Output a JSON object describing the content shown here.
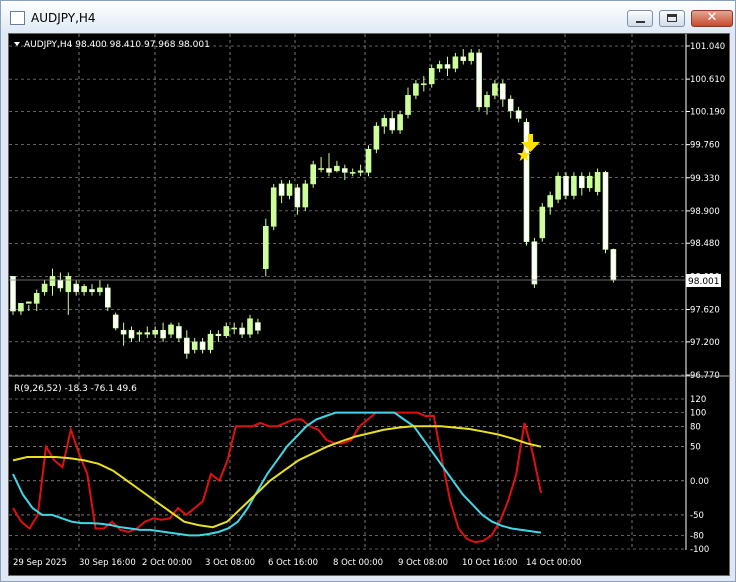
{
  "window": {
    "title": "AUDJPY,H4",
    "buttons": {
      "minimize": "minimize",
      "maximize": "maximize",
      "close": "close"
    },
    "icons": {
      "app": "chart-window-icon",
      "close_glyph": "✕"
    }
  },
  "chart": {
    "header": "AUDJPY,H4  98.400 98.410 97.968 98.001",
    "current_price_label": "98.001",
    "price_axis": [
      "101.040",
      "100.610",
      "100.190",
      "99.760",
      "99.330",
      "98.900",
      "98.480",
      "98.050",
      "97.620",
      "97.200",
      "96.770"
    ],
    "indicator_header": "R(9,26,52) -18.3 -76.1 49.6",
    "indicator_axis": [
      "120",
      "100",
      "80",
      "50",
      "0.00",
      "-50",
      "-80",
      "-100"
    ],
    "time_axis": [
      "29 Sep 2025",
      "30 Sep 16:00",
      "2 Oct 00:00",
      "3 Oct 08:00",
      "6 Oct 16:00",
      "8 Oct 00:00",
      "9 Oct 08:00",
      "10 Oct 16:00",
      "14 Oct 00:00"
    ],
    "colors": {
      "background": "#000000",
      "grid": "#c0c0c0",
      "candle": "#ccff99",
      "line_red": "#e01010",
      "line_cyan": "#40d8e8",
      "line_yellow": "#e8e020",
      "arrow": "#ffe000",
      "text": "#ffffff"
    },
    "icons": {
      "sell_arrow": "down-arrow-icon",
      "signal_star": "star-icon",
      "dropdown": "triangle-down-icon"
    }
  },
  "chart_data": {
    "type": "candlestick",
    "symbol": "AUDJPY",
    "timeframe": "H4",
    "ohlc_last": {
      "open": 98.4,
      "high": 98.41,
      "low": 97.968,
      "close": 98.001
    },
    "ylim": [
      96.77,
      101.04
    ],
    "candles": [
      [
        98.05,
        97.6,
        97.93,
        97.55
      ],
      [
        97.6,
        97.7,
        97.63,
        97.55
      ],
      [
        97.7,
        97.72,
        97.68,
        97.6
      ],
      [
        97.7,
        97.83,
        97.88,
        97.6
      ],
      [
        97.85,
        97.95,
        98.0,
        97.8
      ],
      [
        97.93,
        98.05,
        98.15,
        97.8
      ],
      [
        98.0,
        97.9,
        98.1,
        97.85
      ],
      [
        97.85,
        98.05,
        98.1,
        97.55
      ],
      [
        97.95,
        97.85,
        98.0,
        97.8
      ],
      [
        97.85,
        97.92,
        97.95,
        97.8
      ],
      [
        97.88,
        97.85,
        97.95,
        97.8
      ],
      [
        97.85,
        97.9,
        98.0,
        97.8
      ],
      [
        97.9,
        97.65,
        97.95,
        97.6
      ],
      [
        97.55,
        97.38,
        97.58,
        97.35
      ],
      [
        97.35,
        97.3,
        97.45,
        97.15
      ],
      [
        97.35,
        97.25,
        97.4,
        97.2
      ],
      [
        97.3,
        97.32,
        97.35,
        97.2
      ],
      [
        97.32,
        97.3,
        97.4,
        97.25
      ],
      [
        97.3,
        97.35,
        97.4,
        97.25
      ],
      [
        97.35,
        97.25,
        97.45,
        97.2
      ],
      [
        97.3,
        97.42,
        97.45,
        97.25
      ],
      [
        97.4,
        97.25,
        97.45,
        97.2
      ],
      [
        97.25,
        97.05,
        97.35,
        96.98
      ],
      [
        97.1,
        97.2,
        97.25,
        97.05
      ],
      [
        97.2,
        97.1,
        97.25,
        97.05
      ],
      [
        97.1,
        97.3,
        97.35,
        97.05
      ],
      [
        97.3,
        97.28,
        97.35,
        97.2
      ],
      [
        97.28,
        97.4,
        97.45,
        97.25
      ],
      [
        97.38,
        97.38,
        97.45,
        97.3
      ],
      [
        97.38,
        97.3,
        97.45,
        97.25
      ],
      [
        97.3,
        97.5,
        97.55,
        97.25
      ],
      [
        97.45,
        97.35,
        97.5,
        97.3
      ],
      [
        98.15,
        98.7,
        98.8,
        98.05
      ],
      [
        98.7,
        99.2,
        99.25,
        98.65
      ],
      [
        99.25,
        99.1,
        99.3,
        99.0
      ],
      [
        99.1,
        99.25,
        99.3,
        99.05
      ],
      [
        99.2,
        98.95,
        99.25,
        98.85
      ],
      [
        98.95,
        99.25,
        99.3,
        98.9
      ],
      [
        99.25,
        99.5,
        99.55,
        99.2
      ],
      [
        99.45,
        99.45,
        99.6,
        99.4
      ],
      [
        99.45,
        99.4,
        99.65,
        99.35
      ],
      [
        99.42,
        99.48,
        99.55,
        99.4
      ],
      [
        99.45,
        99.4,
        99.5,
        99.3
      ],
      [
        99.4,
        99.4,
        99.45,
        99.35
      ],
      [
        99.4,
        99.42,
        99.5,
        99.35
      ],
      [
        99.4,
        99.7,
        99.75,
        99.35
      ],
      [
        99.7,
        100.0,
        100.05,
        99.65
      ],
      [
        100.0,
        100.1,
        100.15,
        99.9
      ],
      [
        100.1,
        99.95,
        100.2,
        99.9
      ],
      [
        99.95,
        100.15,
        100.2,
        99.9
      ],
      [
        100.15,
        100.4,
        100.5,
        100.1
      ],
      [
        100.4,
        100.55,
        100.6,
        100.35
      ],
      [
        100.55,
        100.55,
        100.65,
        100.45
      ],
      [
        100.55,
        100.75,
        100.8,
        100.5
      ],
      [
        100.75,
        100.8,
        100.85,
        100.7
      ],
      [
        100.8,
        100.75,
        100.9,
        100.65
      ],
      [
        100.75,
        100.9,
        100.95,
        100.7
      ],
      [
        100.9,
        100.85,
        101.0,
        100.8
      ],
      [
        100.85,
        100.95,
        101.0,
        100.8
      ],
      [
        100.95,
        100.25,
        101.0,
        100.2
      ],
      [
        100.25,
        100.4,
        100.45,
        100.15
      ],
      [
        100.4,
        100.55,
        100.6,
        100.35
      ],
      [
        100.55,
        100.35,
        100.6,
        100.25
      ],
      [
        100.35,
        100.2,
        100.4,
        100.1
      ],
      [
        100.2,
        100.1,
        100.25,
        100.05
      ],
      [
        100.05,
        98.5,
        100.1,
        98.45
      ],
      [
        98.5,
        97.95,
        98.55,
        97.9
      ],
      [
        98.55,
        98.95,
        99.0,
        98.5
      ],
      [
        98.95,
        99.1,
        99.15,
        98.85
      ],
      [
        99.05,
        99.35,
        99.4,
        99.0
      ],
      [
        99.35,
        99.1,
        99.4,
        99.05
      ],
      [
        99.1,
        99.35,
        99.4,
        99.05
      ],
      [
        99.35,
        99.2,
        99.4,
        99.1
      ],
      [
        99.2,
        99.35,
        99.4,
        99.15
      ],
      [
        99.15,
        99.4,
        99.45,
        99.1
      ],
      [
        99.4,
        98.4,
        99.42,
        98.35
      ],
      [
        98.4,
        98.0,
        98.41,
        97.97
      ]
    ],
    "indicator": {
      "name": "R(9,26,52)",
      "values_last": [
        -18.3,
        -76.1,
        49.6
      ],
      "ylim": [
        -100,
        120
      ],
      "series": [
        {
          "color": "#e01010",
          "values": [
            -40,
            -60,
            -70,
            -50,
            50,
            30,
            20,
            75,
            40,
            10,
            -70,
            -70,
            -60,
            -72,
            -75,
            -70,
            -60,
            -55,
            -57,
            -55,
            -40,
            -50,
            -40,
            -30,
            10,
            0,
            30,
            80,
            80,
            80,
            85,
            80,
            80,
            85,
            90,
            90,
            80,
            75,
            60,
            55,
            55,
            60,
            80,
            90,
            100,
            100,
            100,
            100,
            100,
            100,
            95,
            95,
            30,
            -30,
            -70,
            -85,
            -90,
            -88,
            -80,
            -60,
            -30,
            10,
            85,
            40,
            -18
          ]
        },
        {
          "color": "#40d8e8",
          "values": [
            10,
            -20,
            -40,
            -50,
            -50,
            -55,
            -60,
            -62,
            -62,
            -63,
            -65,
            -68,
            -70,
            -72,
            -72,
            -74,
            -76,
            -78,
            -80,
            -80,
            -78,
            -75,
            -70,
            -60,
            -40,
            -15,
            10,
            30,
            50,
            65,
            80,
            90,
            95,
            100,
            100,
            100,
            100,
            100,
            100,
            100,
            90,
            80,
            60,
            40,
            20,
            0,
            -20,
            -35,
            -50,
            -60,
            -66,
            -70,
            -72,
            -74,
            -76
          ]
        },
        {
          "color": "#e8e020",
          "values": [
            30,
            35,
            35,
            35,
            33,
            30,
            25,
            15,
            0,
            -15,
            -30,
            -45,
            -60,
            -65,
            -68,
            -60,
            -40,
            -20,
            0,
            15,
            30,
            40,
            50,
            58,
            65,
            70,
            75,
            78,
            80,
            80,
            80,
            78,
            76,
            72,
            68,
            62,
            55,
            50
          ]
        }
      ]
    }
  }
}
